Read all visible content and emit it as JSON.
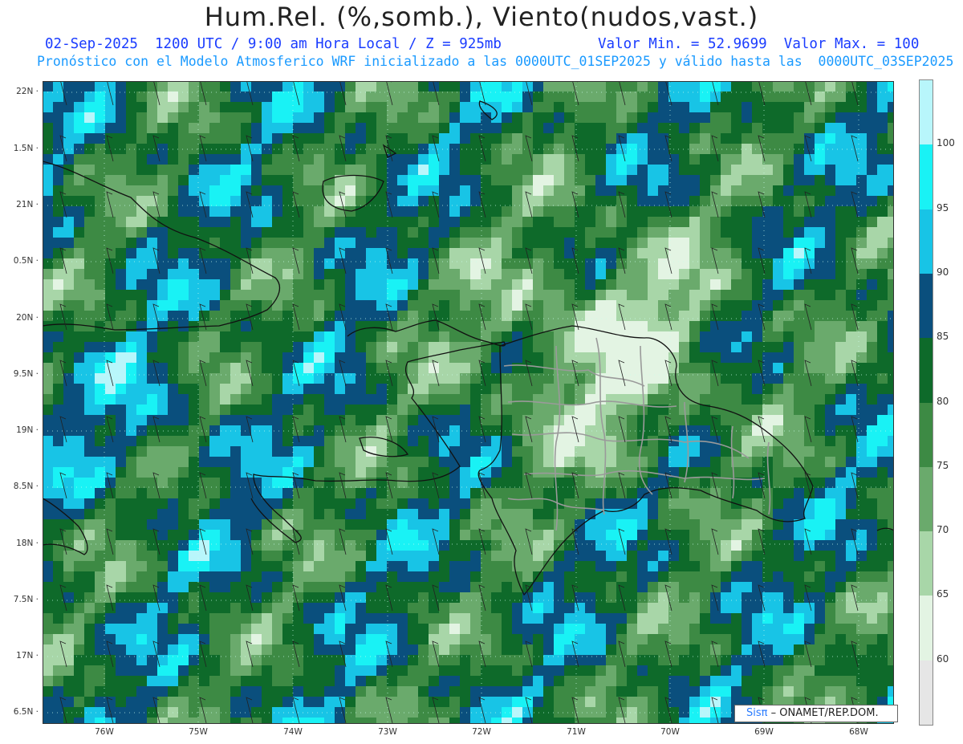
{
  "title": "Hum.Rel. (%,somb.), Viento(nudos,vast.)",
  "subtitle_left": "02-Sep-2025  1200 UTC / 9:00 am Hora Local / Z = 925mb",
  "subtitle_right": "Valor Min. = 52.9699  Valor Max. = 100",
  "subtitle_2": "Pronóstico con el Modelo Atmosferico WRF inicializado a las 0000UTC_01SEP2025 y válido hasta las  0000UTC_03SEP2025",
  "y_ticks": [
    "22N",
    "1.5N",
    "21N",
    "0.5N",
    "20N",
    "9.5N",
    "19N",
    "8.5N",
    "18N",
    "7.5N",
    "17N",
    "6.5N"
  ],
  "x_ticks": [
    "76W",
    "75W",
    "74W",
    "73W",
    "72W",
    "71W",
    "70W",
    "69W",
    "68W"
  ],
  "colorbar": {
    "labels": [
      "100",
      "95",
      "90",
      "85",
      "80",
      "75",
      "70",
      "65",
      "60"
    ],
    "colors": [
      "#b8f6fb",
      "#19f2f5",
      "#18c4e6",
      "#0a4f7d",
      "#0e6a2a",
      "#3d8a44",
      "#6aaa6c",
      "#a8d6a8",
      "#e3f4e3",
      "#e6e6e6"
    ]
  },
  "credit": {
    "logo": "Sisπ",
    "text": " – ONAMET/REP.DOM."
  },
  "map_extent": {
    "lon": [
      -76.65,
      -67.6
    ],
    "lat": [
      16.45,
      22.2
    ]
  }
}
